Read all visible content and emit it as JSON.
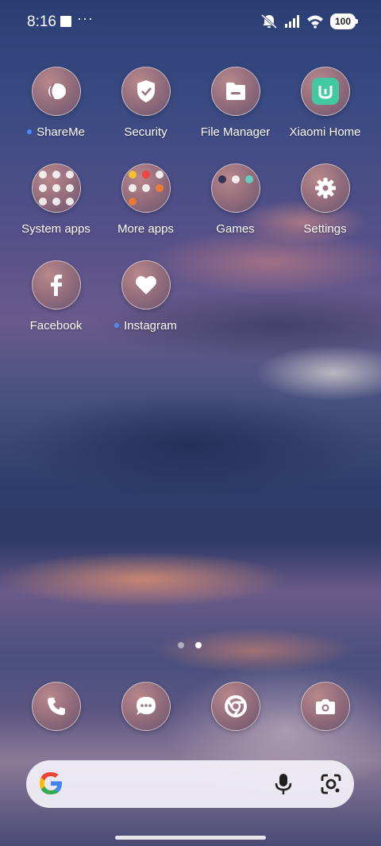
{
  "status_bar": {
    "time": "8:16",
    "notification_dots": "···",
    "battery": "100"
  },
  "apps": {
    "shareme": "ShareMe",
    "security": "Security",
    "file_manager": "File Manager",
    "xiaomi_home": "Xiaomi Home",
    "system_apps": "System apps",
    "more_apps": "More apps",
    "games": "Games",
    "settings": "Settings",
    "facebook": "Facebook",
    "instagram": "Instagram"
  },
  "pager": {
    "pages": 2,
    "current": 2
  },
  "colors": {
    "new_dot": "#4a8cff",
    "xiaomi_home_accent": "#42c9a0"
  }
}
